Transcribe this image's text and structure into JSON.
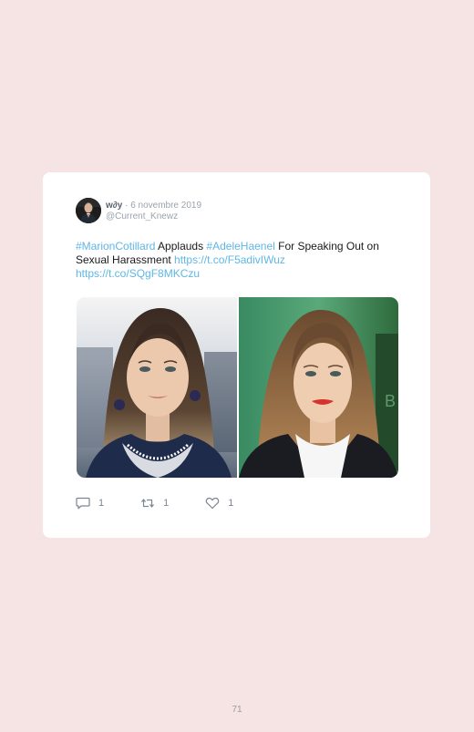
{
  "tweet": {
    "author_name": "w∂y",
    "separator": "·",
    "date": "6 novembre 2019",
    "handle": "@Current_Knewz",
    "text_parts": {
      "hashtag1": "#MarionCotillard",
      "text1": " Applauds ",
      "hashtag2": "#AdeleHaenel",
      "text2": " For Speaking Out on Sexual Harassment ",
      "link1": "https://t.co/F5adivIWuz",
      "link2": "https://t.co/SQgF8MKCzu"
    },
    "actions": {
      "reply_count": "1",
      "retweet_count": "1",
      "like_count": "1"
    }
  },
  "page": {
    "number": "71"
  },
  "colors": {
    "background": "#f6e4e5",
    "link": "#5fb6e6",
    "card": "#ffffff"
  },
  "icons": [
    "reply-icon",
    "retweet-icon",
    "like-icon"
  ]
}
